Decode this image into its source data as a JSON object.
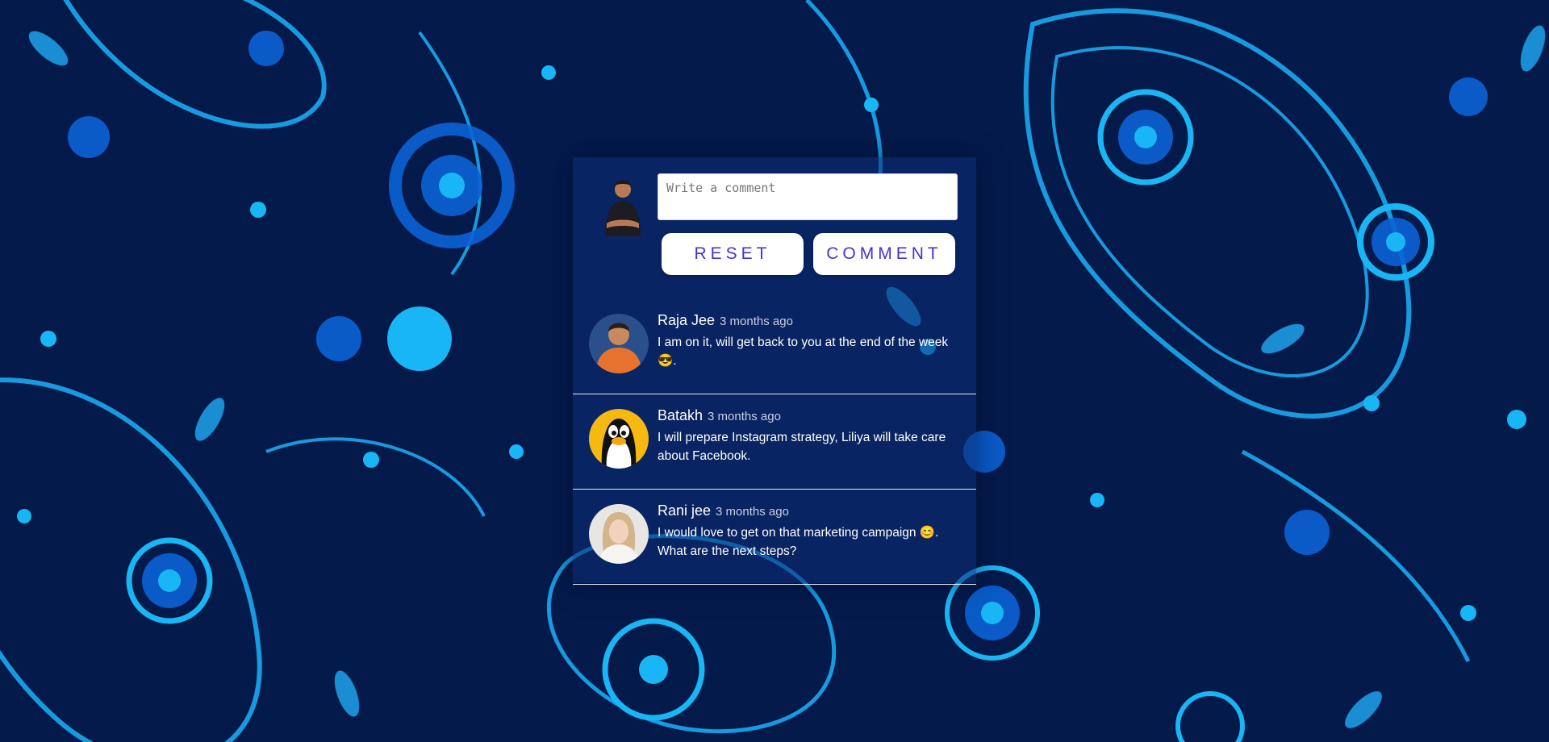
{
  "composer": {
    "placeholder": "Write a comment",
    "reset_label": "RESET",
    "comment_label": "COMMENT"
  },
  "comments": [
    {
      "name": "Raja Jee",
      "time": "3 months ago",
      "text": "I am on it, will get back to you at the end of the week 😎."
    },
    {
      "name": "Batakh",
      "time": "3 months ago",
      "text": "I will prepare Instagram strategy, Liliya will take care about Facebook."
    },
    {
      "name": "Rani jee",
      "time": "3 months ago",
      "text": "I would love to get on that marketing campaign 😊. What are the next steps?"
    }
  ],
  "colors": {
    "background": "#041a4a",
    "pattern_light": "#19b6f5",
    "pattern_mid": "#0b63d6",
    "button_text": "#4a2fd6"
  }
}
